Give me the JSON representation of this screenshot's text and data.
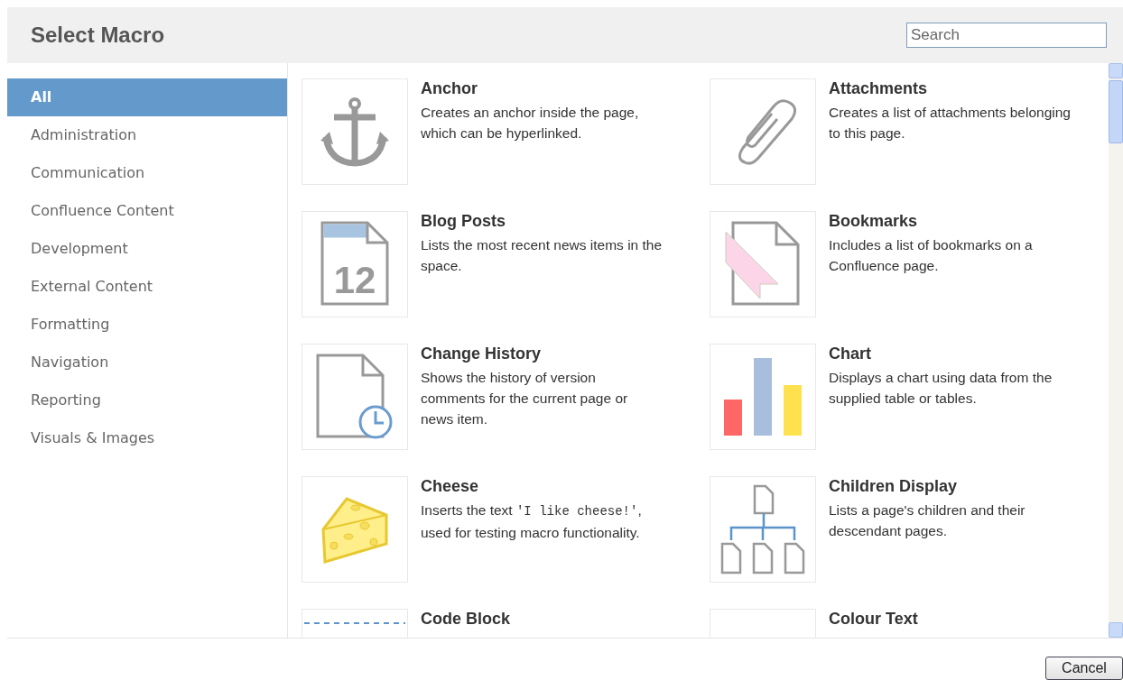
{
  "dialog": {
    "title": "Select Macro"
  },
  "search": {
    "placeholder": "Search"
  },
  "categories": [
    {
      "label": "All",
      "selected": true
    },
    {
      "label": "Administration",
      "selected": false
    },
    {
      "label": "Communication",
      "selected": false
    },
    {
      "label": "Confluence Content",
      "selected": false
    },
    {
      "label": "Development",
      "selected": false
    },
    {
      "label": "External Content",
      "selected": false
    },
    {
      "label": "Formatting",
      "selected": false
    },
    {
      "label": "Navigation",
      "selected": false
    },
    {
      "label": "Reporting",
      "selected": false
    },
    {
      "label": "Visuals & Images",
      "selected": false
    }
  ],
  "macros": [
    {
      "kind": "anchor",
      "name": "Anchor",
      "description": [
        {
          "kind": "text",
          "text": "Creates an anchor inside the page, which can be hyperlinked."
        }
      ]
    },
    {
      "kind": "paperclip",
      "name": "Attachments",
      "description": [
        {
          "kind": "text",
          "text": "Creates a list of attachments belonging to this page."
        }
      ]
    },
    {
      "kind": "calendar",
      "icon_label": "12",
      "name": "Blog Posts",
      "description": [
        {
          "kind": "text",
          "text": "Lists the most recent news items in the space."
        }
      ]
    },
    {
      "kind": "bookmark",
      "name": "Bookmarks",
      "description": [
        {
          "kind": "text",
          "text": "Includes a list of bookmarks on a Confluence page."
        }
      ]
    },
    {
      "kind": "history",
      "name": "Change History",
      "description": [
        {
          "kind": "text",
          "text": "Shows the history of version comments for the current page or news item."
        }
      ]
    },
    {
      "kind": "chart",
      "name": "Chart",
      "description": [
        {
          "kind": "text",
          "text": "Displays a chart using data from the supplied table or tables."
        }
      ]
    },
    {
      "kind": "cheese",
      "name": "Cheese",
      "description": [
        {
          "kind": "text",
          "text": "Inserts the text "
        },
        {
          "kind": "code",
          "text": "'I like cheese!'"
        },
        {
          "kind": "text",
          "text": ", used for testing macro functionality."
        }
      ]
    },
    {
      "kind": "tree",
      "name": "Children Display",
      "description": [
        {
          "kind": "text",
          "text": "Lists a page's children and their descendant pages."
        }
      ]
    },
    {
      "kind": "code",
      "name": "Code Block"
    },
    {
      "kind": "blank",
      "name": "Colour Text"
    }
  ],
  "buttons": [
    {
      "label": "Cancel"
    }
  ]
}
